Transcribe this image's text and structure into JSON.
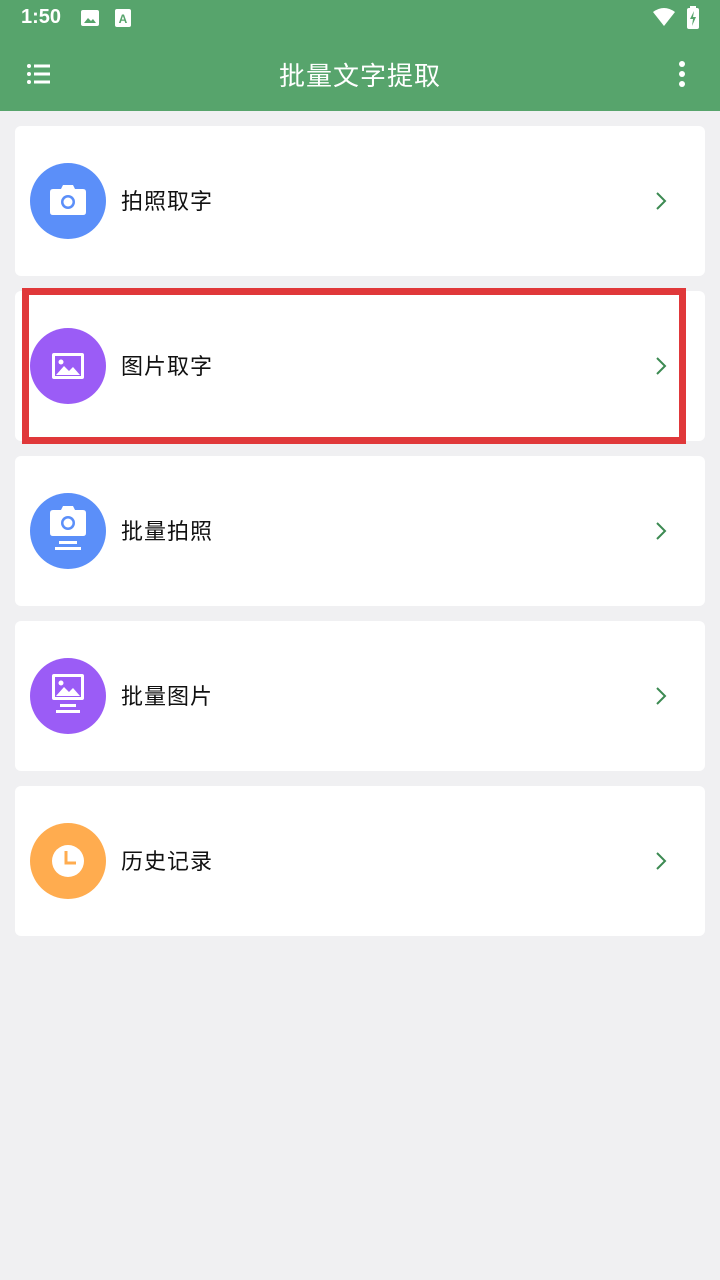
{
  "status_bar": {
    "time": "1:50",
    "left_icons": [
      "image-icon",
      "a-icon"
    ],
    "right_icons": [
      "wifi-icon",
      "battery-charging-icon"
    ]
  },
  "app_bar": {
    "title": "批量文字提取",
    "menu_icon": "list-menu-icon",
    "more_icon": "more-vert-icon",
    "color": "#57a46c"
  },
  "menu_items": [
    {
      "label": "拍照取字",
      "icon": "camera-icon",
      "color": "#5b8ff9"
    },
    {
      "label": "图片取字",
      "icon": "image-icon",
      "color": "#9b5cf6"
    },
    {
      "label": "批量拍照",
      "icon": "batch-camera-icon",
      "color": "#5b8ff9"
    },
    {
      "label": "批量图片",
      "icon": "batch-image-icon",
      "color": "#9b5cf6"
    },
    {
      "label": "历史记录",
      "icon": "clock-icon",
      "color": "#ffac4f"
    }
  ],
  "highlight_color": "#e0383a"
}
